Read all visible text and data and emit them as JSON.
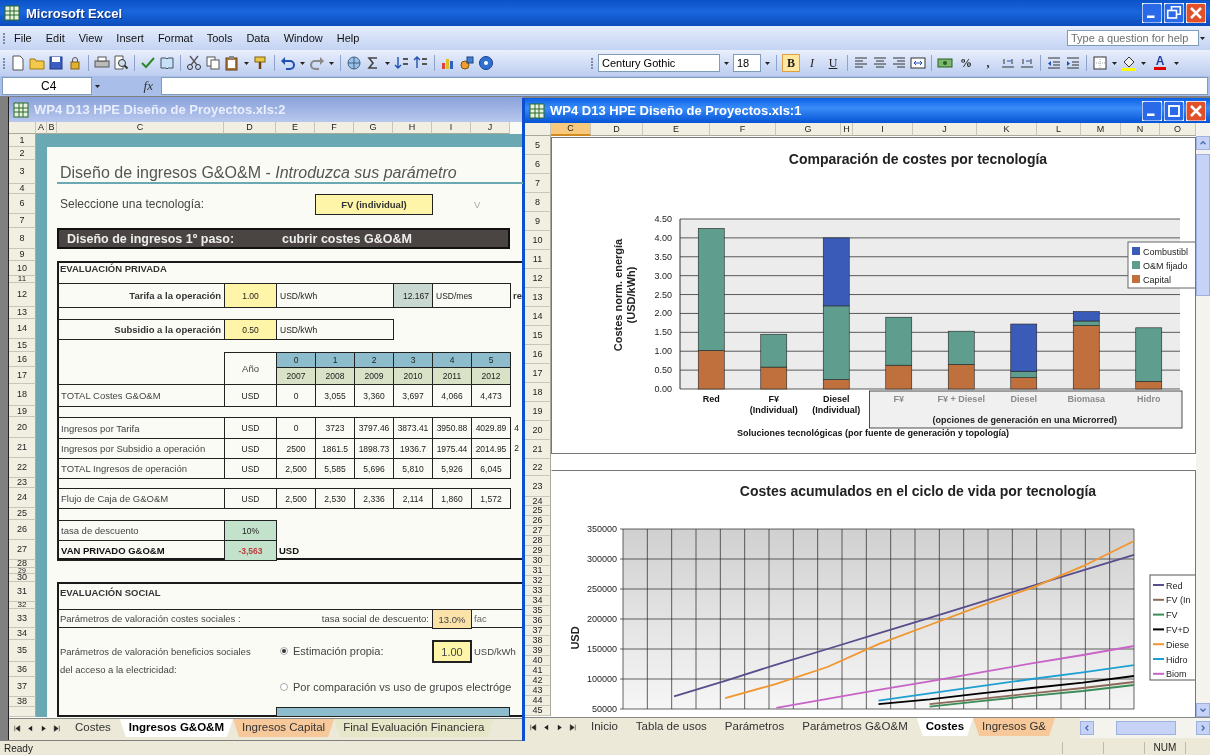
{
  "app": {
    "title": "Microsoft Excel"
  },
  "menu": [
    {
      "label": "File"
    },
    {
      "label": "Edit"
    },
    {
      "label": "View"
    },
    {
      "label": "Insert"
    },
    {
      "label": "Format"
    },
    {
      "label": "Tools"
    },
    {
      "label": "Data"
    },
    {
      "label": "Window"
    },
    {
      "label": "Help"
    }
  ],
  "help_box": {
    "placeholder": "Type a question for help"
  },
  "format_toolbar": {
    "font": "Century Gothic",
    "size": "18",
    "style_buttons": [
      {
        "label": "B",
        "pressed": true
      },
      {
        "label": "I",
        "pressed": false
      },
      {
        "label": "U",
        "pressed": false
      }
    ],
    "number_buttons": [
      "%",
      ","
    ],
    "font_color": "A"
  },
  "formula_bar": {
    "name_box": "C4",
    "function_label": "fx"
  },
  "left_window": {
    "title": "WP4 D13 HPE Diseño de Proyectos.xls:2",
    "active": false,
    "columns": [
      "A",
      "B",
      "C",
      "D",
      "E",
      "F",
      "G",
      "H",
      "I",
      "J"
    ],
    "rows": [
      "1",
      "2",
      "3",
      "4",
      "6",
      "7",
      "8",
      "9",
      "10",
      "11",
      "12",
      "13",
      "14",
      "15",
      "16",
      "17",
      "18",
      "19",
      "20",
      "21",
      "22",
      "23",
      "24",
      "25",
      "26",
      "27",
      "28",
      "29",
      "30",
      "31",
      "32",
      "33",
      "34",
      "35",
      "36",
      "37",
      "38"
    ],
    "heading": "Diseño de ingresos G&O&M - *Introduzca sus parámetro*",
    "technology": {
      "label": "Seleccione una tecnología:",
      "value": "FV (individual)",
      "column_j": "V"
    },
    "step_banner": {
      "label": "Diseño de ingresos 1º paso:",
      "value": "cubrir costes G&O&M"
    },
    "private": {
      "title": "EVALUACIÓN PRIVADA",
      "tariff": {
        "label": "Tarifa a la operación",
        "value": "1.00",
        "unit": "USD/kWh",
        "monthly": "12.167",
        "monthly_unit": "USD/mes",
        "column_k": "re"
      },
      "subsidy": {
        "label": "Subsidio a la operación",
        "value": "0.50",
        "unit": "USD/kWh"
      },
      "year_label": "Año",
      "periods": [
        "0",
        "1",
        "2",
        "3",
        "4",
        "5"
      ],
      "years": [
        "2007",
        "2008",
        "2009",
        "2010",
        "2011",
        "2012"
      ],
      "rows": [
        {
          "label": "TOTAL Costes G&O&M",
          "unit": "USD",
          "values": [
            "0",
            "3,055",
            "3,360",
            "3,697",
            "4,066",
            "4,473"
          ]
        },
        {
          "label": "Ingresos por Tarifa",
          "unit": "USD",
          "values": [
            "0",
            "3723",
            "3797.46",
            "3873.41",
            "3950.88",
            "4029.89",
            "4"
          ]
        },
        {
          "label": "Ingresos por Subsidio a operación",
          "unit": "USD",
          "values": [
            "2500",
            "1861.5",
            "1898.73",
            "1936.7",
            "1975.44",
            "2014.95",
            "2"
          ]
        },
        {
          "label": "TOTAL Ingresos de operación",
          "unit": "USD",
          "values": [
            "2,500",
            "5,585",
            "5,696",
            "5,810",
            "5,926",
            "6,045"
          ]
        },
        {
          "label": "Flujo de Caja de G&O&M",
          "unit": "USD",
          "values": [
            "2,500",
            "2,530",
            "2,336",
            "2,114",
            "1,860",
            "1,572"
          ]
        }
      ],
      "discount": {
        "label": "tasa de descuento",
        "value": "10%"
      },
      "npv": {
        "label": "VAN PRIVADO G&O&M",
        "value": "-3,563",
        "unit": "USD"
      }
    },
    "social": {
      "title": "EVALUACIÓN SOCIAL",
      "cost_params": "Parámetros de valoración costes sociales :",
      "rate_label": "tasa social de descuento:",
      "rate": "13.0%",
      "column_j": "fac",
      "benefit_params": [
        "Parámetros de valoración beneficios sociales",
        "del acceso a la electricidad:"
      ],
      "options": [
        {
          "label": "Estimación propia:",
          "selected": true
        },
        {
          "label": "Por comparación vs uso de grupos electróge",
          "selected": false
        }
      ],
      "own_value": "1.00",
      "own_unit": "USD/kWh"
    },
    "tabs": [
      {
        "label": "Costes",
        "selected": false,
        "color": "#ece9d8"
      },
      {
        "label": "Ingresos G&O&M",
        "selected": true,
        "color": "#ffffff"
      },
      {
        "label": "Ingresos Capital",
        "selected": false,
        "color": "#f6c89a"
      },
      {
        "label": "Final Evaluación Financiera",
        "selected": false,
        "color": "#e6e6c8"
      }
    ]
  },
  "right_window": {
    "title": "WP4 D13 HPE Diseño de Proyectos.xls:1",
    "active": true,
    "columns": [
      {
        "label": "C",
        "selected": true
      },
      {
        "label": "D",
        "selected": false
      },
      {
        "label": "E",
        "selected": false
      },
      {
        "label": "F",
        "selected": false
      },
      {
        "label": "G",
        "selected": false
      },
      {
        "label": "H",
        "selected": false
      },
      {
        "label": "I",
        "selected": false
      },
      {
        "label": "J",
        "selected": false
      },
      {
        "label": "K",
        "selected": false
      },
      {
        "label": "L",
        "selected": false
      },
      {
        "label": "M",
        "selected": false
      },
      {
        "label": "N",
        "selected": false
      },
      {
        "label": "O",
        "selected": false
      }
    ],
    "rows": [
      "5",
      "6",
      "7",
      "8",
      "9",
      "10",
      "11",
      "12",
      "13",
      "14",
      "15",
      "16",
      "17",
      "18",
      "19",
      "20",
      "21",
      "22",
      "23",
      "24",
      "25",
      "26",
      "27",
      "28",
      "29",
      "30",
      "31",
      "32",
      "33",
      "34",
      "35",
      "36",
      "37",
      "38",
      "39",
      "40",
      "41",
      "42",
      "43",
      "44",
      "45"
    ],
    "bar_chart": {
      "chart_data": {
        "type": "bar",
        "title": "Comparación de costes por tecnología",
        "ylabel": "Costes norm. energía\n(USD/kWh)",
        "xlabel": "Soluciones tecnológicas  (por fuente de generación y topología)",
        "categories": [
          "Red",
          "F¥\n(Individual)",
          "Diesel\n(Individual)",
          "F¥",
          "F¥ + Diesel",
          "Diesel",
          "Biomasa",
          "Hidro"
        ],
        "series": [
          {
            "name": "Capital",
            "color": "#c0703c",
            "values": [
              1.02,
              0.58,
              0.25,
              0.63,
              0.65,
              0.3,
              1.68,
              0.2
            ]
          },
          {
            "name": "O&M fijado",
            "color": "#5f9e8e",
            "values": [
              3.23,
              0.87,
              1.95,
              1.27,
              0.88,
              0.17,
              0.12,
              1.42
            ]
          },
          {
            "name": "Combustibl",
            "color": "#3a5cb8",
            "values": [
              0,
              0,
              1.8,
              0,
              0,
              1.25,
              0.25,
              0
            ]
          }
        ],
        "stacked": true,
        "grid": true,
        "legend": "right",
        "ylim": [
          0,
          4.5
        ],
        "yticks": [
          {
            "value": 0,
            "label": "0.00"
          },
          {
            "value": 0.5,
            "label": "0.50"
          },
          {
            "value": 1,
            "label": "1.00"
          },
          {
            "value": 1.5,
            "label": "1.50"
          },
          {
            "value": 2,
            "label": "2.00"
          },
          {
            "value": 2.5,
            "label": "2.50"
          },
          {
            "value": 3,
            "label": "3.00"
          },
          {
            "value": 3.5,
            "label": "3.50"
          },
          {
            "value": 4,
            "label": "4.00"
          },
          {
            "value": 4.5,
            "label": "4.50"
          }
        ],
        "annotations": [
          {
            "text": "(opciones de generación en una Microrred)"
          }
        ]
      }
    },
    "line_chart": {
      "chart_data": {
        "type": "line",
        "title": "Costes acumulados en el ciclo de vida por tecnología",
        "ylabel": "USD",
        "grid": true,
        "legend": "right",
        "ylim": [
          50000,
          350000
        ],
        "yticks": [
          50000,
          100000,
          150000,
          200000,
          250000,
          300000,
          350000
        ],
        "series": [
          {
            "name": "Red",
            "color": "#5a4d8c",
            "values": [
              null,
              71000,
              97000,
              124000,
              150000,
              176000,
              202000,
              228000,
              255000,
              281000,
              307000
            ]
          },
          {
            "name": "FV (In",
            "color": "#8c6a5a",
            "values": [
              null,
              null,
              null,
              null,
              null,
              null,
              58000,
              67000,
              76000,
              85000,
              95000
            ]
          },
          {
            "name": "FV",
            "color": "#3c8c5a",
            "values": [
              null,
              null,
              null,
              null,
              null,
              null,
              54000,
              63000,
              72000,
              80000,
              90000
            ]
          },
          {
            "name": "FV+D",
            "color": "#000000",
            "values": [
              null,
              null,
              null,
              null,
              null,
              58000,
              66000,
              76000,
              85000,
              94000,
              105000
            ]
          },
          {
            "name": "Diese",
            "color": "#f0962d",
            "values": [
              null,
              null,
              68000,
              92000,
              120000,
              158000,
              190000,
              222000,
              252000,
              288000,
              330000
            ]
          },
          {
            "name": "Hidro",
            "color": "#1ea0d2",
            "values": [
              null,
              null,
              null,
              null,
              null,
              64000,
              76000,
              88000,
              100000,
              111000,
              123000
            ]
          },
          {
            "name": "Biom",
            "color": "#c864c8",
            "values": [
              null,
              null,
              null,
              52000,
              67000,
              82000,
              96000,
              111000,
              126000,
              140000,
              155000
            ]
          }
        ]
      }
    },
    "tabs": [
      {
        "label": "Inicio",
        "selected": false,
        "color": "#ece9d8"
      },
      {
        "label": "Tabla de usos",
        "selected": false,
        "color": "#ece9d8"
      },
      {
        "label": "Parámetros",
        "selected": false,
        "color": "#ece9d8"
      },
      {
        "label": "Parámetros G&O&M",
        "selected": false,
        "color": "#ece9d8"
      },
      {
        "label": "Costes",
        "selected": true,
        "color": "#ffffff"
      },
      {
        "label": "Ingresos G&",
        "selected": false,
        "color": "#f6c89a"
      }
    ]
  },
  "status_bar": {
    "text": "Ready",
    "indicators": [
      "NUM"
    ]
  }
}
